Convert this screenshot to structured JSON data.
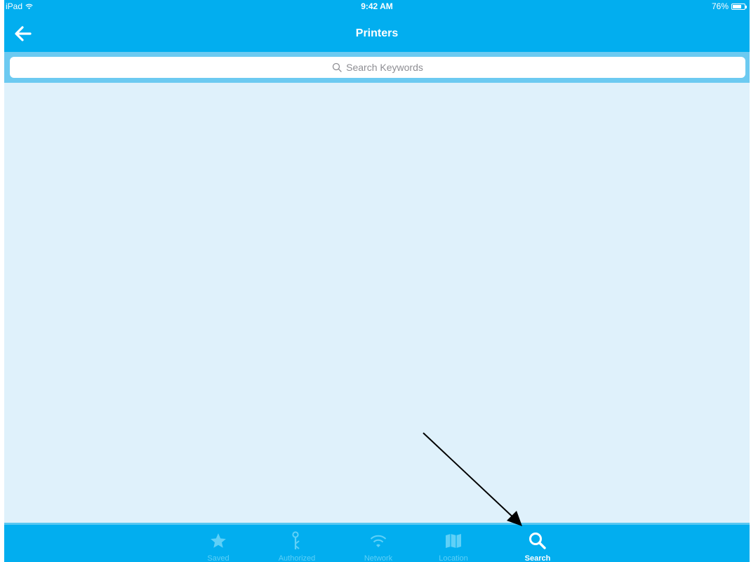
{
  "status_bar": {
    "device": "iPad",
    "time": "9:42 AM",
    "battery_percent_label": "76%",
    "battery_level": 0.76
  },
  "nav_bar": {
    "title": "Printers",
    "back_icon": "back-arrow-icon"
  },
  "search": {
    "placeholder": "Search Keywords",
    "icon": "search-icon"
  },
  "tab_bar": {
    "tabs": [
      {
        "label": "Saved",
        "icon": "star-icon",
        "active": false
      },
      {
        "label": "Authorized",
        "icon": "key-icon",
        "active": false
      },
      {
        "label": "Network",
        "icon": "wifi-icon",
        "active": false
      },
      {
        "label": "Location",
        "icon": "map-icon",
        "active": false
      },
      {
        "label": "Search",
        "icon": "search-icon",
        "active": true
      }
    ]
  },
  "colors": {
    "bar": "#02aeef",
    "content_bg": "#dff1fb",
    "inactive_tab": "#5fd0f7",
    "active_tab": "#ffffff"
  }
}
